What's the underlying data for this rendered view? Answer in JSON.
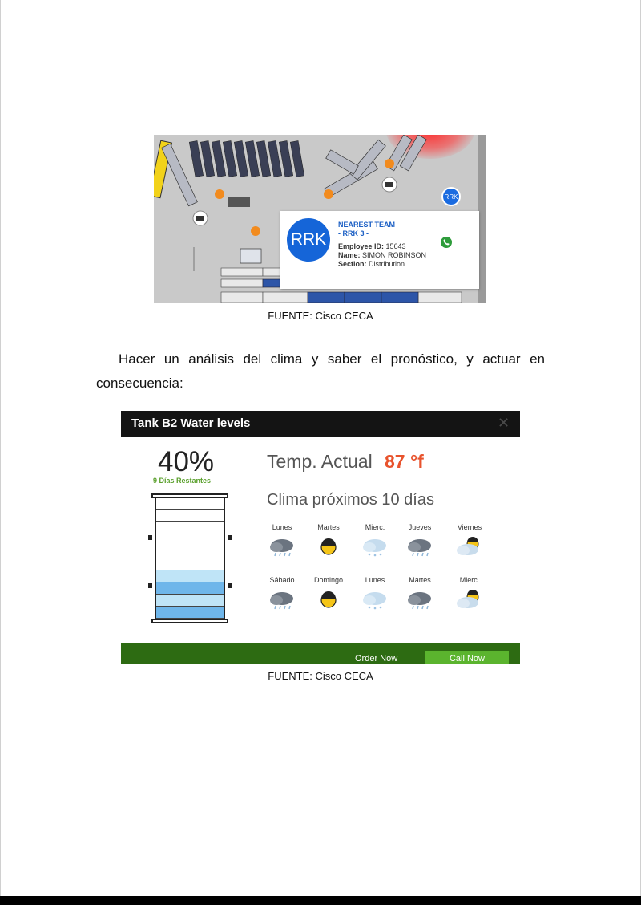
{
  "figure1": {
    "card": {
      "avatar_text": "RRK",
      "small_avatar_text": "RRK",
      "title_line1": "NEAREST TEAM",
      "title_line2": "- RRK 3 -",
      "employee_id_label": "Employee ID:",
      "employee_id": "15643",
      "name_label": "Name:",
      "name": "SIMON ROBINSON",
      "section_label": "Section:",
      "section": "Distribution"
    },
    "caption": "FUENTE: Cisco CECA"
  },
  "paragraph": "Hacer un análisis del clima y saber el pronóstico, y actuar en consecuencia:",
  "figure2": {
    "title": "Tank B2 Water levels",
    "close_glyph": "✕",
    "level_percent_text": "40%",
    "level_fraction": 0.4,
    "days_left": "9 Días Restantes",
    "temp_label": "Temp. Actual",
    "temp_value": "87 °f",
    "forecast_title": "Clima próximos 10 días",
    "forecast": [
      {
        "day": "Lunes",
        "icon": "rain-cloud-icon"
      },
      {
        "day": "Martes",
        "icon": "sun-icon"
      },
      {
        "day": "Mierc.",
        "icon": "snow-cloud-icon"
      },
      {
        "day": "Jueves",
        "icon": "rain-cloud-icon"
      },
      {
        "day": "Viernes",
        "icon": "partly-sunny-icon"
      },
      {
        "day": "Sábado",
        "icon": "rain-cloud-icon"
      },
      {
        "day": "Domingo",
        "icon": "sun-icon"
      },
      {
        "day": "Lunes",
        "icon": "snow-cloud-icon"
      },
      {
        "day": "Martes",
        "icon": "rain-cloud-icon"
      },
      {
        "day": "Mierc.",
        "icon": "partly-sunny-icon"
      }
    ],
    "order_label": "Order Now",
    "call_label": "Call Now",
    "caption": "FUENTE: Cisco CECA"
  },
  "colors": {
    "accent_blue": "#1565d8",
    "temp_orange": "#e8532d",
    "days_green": "#5aa02c",
    "footer_green": "#2d6b12",
    "call_green": "#5bb42e",
    "water_light": "#bfe4f7",
    "water_dark": "#6fb6ea"
  }
}
